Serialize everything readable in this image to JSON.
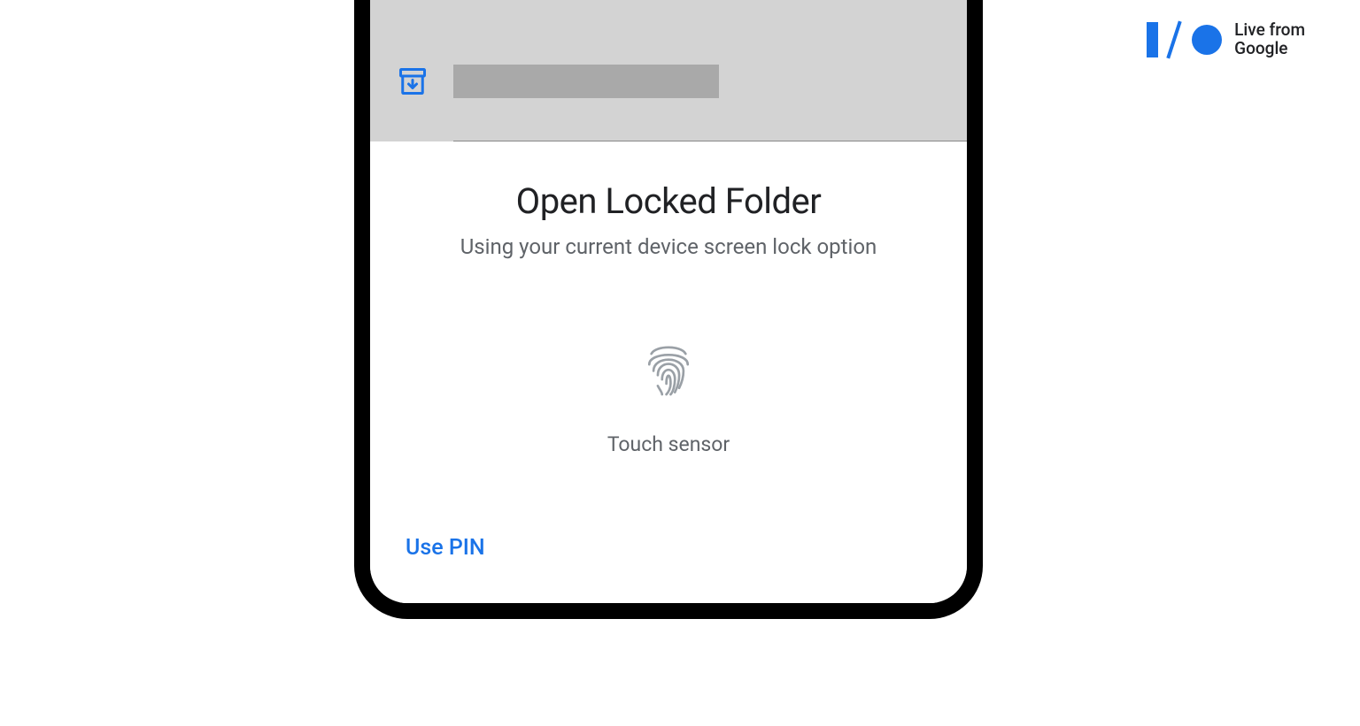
{
  "dialog": {
    "title": "Open Locked Folder",
    "subtitle": "Using your current device screen lock option",
    "sensor_label": "Touch sensor",
    "use_pin_label": "Use PIN"
  },
  "branding": {
    "line1": "Live from",
    "line2": "Google"
  },
  "colors": {
    "accent": "#1a73e8",
    "text_primary": "#202124",
    "text_secondary": "#5f6368"
  }
}
